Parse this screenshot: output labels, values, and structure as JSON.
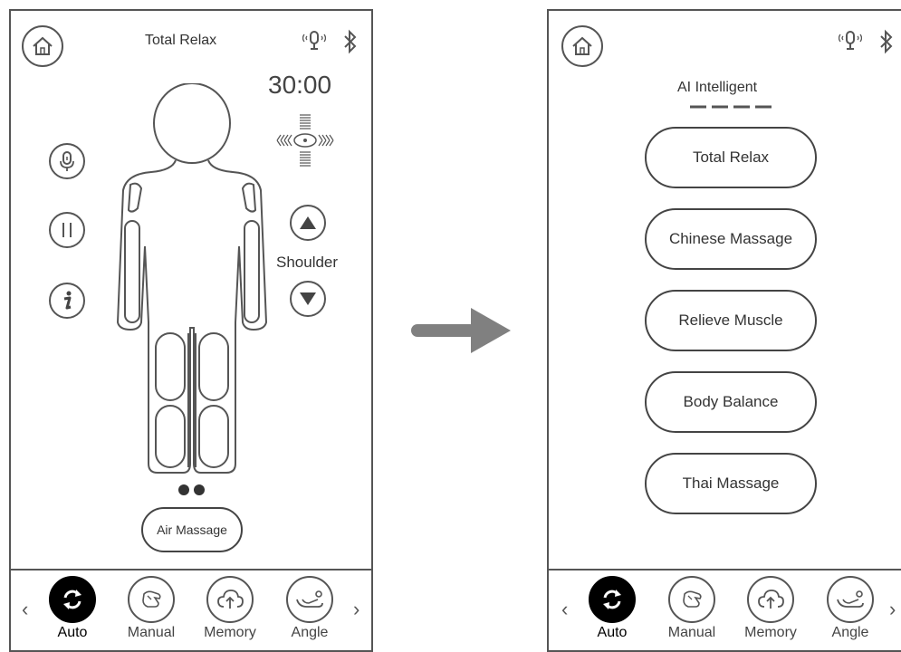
{
  "left_screen": {
    "title": "Total Relax",
    "timer": "30:00",
    "body_position_label": "Shoulder",
    "air_massage_button": "Air Massage",
    "icons": {
      "home": "home-icon",
      "voice": "microphone-icon",
      "bluetooth": "bluetooth-icon",
      "pause": "pause-icon",
      "info": "info-icon",
      "up": "triangle-up-icon",
      "down": "triangle-down-icon",
      "intensity": "intensity-cross-icon"
    }
  },
  "right_screen": {
    "section_title": "AI Intelligent",
    "programs": [
      "Total Relax",
      "Chinese Massage",
      "Relieve Muscle",
      "Body Balance",
      "Thai Massage"
    ]
  },
  "nav": {
    "prev": "‹",
    "next": "›",
    "items": [
      {
        "label": "Auto",
        "icon": "auto-sync-icon",
        "active": true
      },
      {
        "label": "Manual",
        "icon": "hand-icon",
        "active": false
      },
      {
        "label": "Memory",
        "icon": "cloud-upload-icon",
        "active": false
      },
      {
        "label": "Angle",
        "icon": "recline-icon",
        "active": false
      }
    ]
  },
  "arrow": "right-arrow-icon",
  "colors": {
    "stroke": "#555555",
    "active": "#000000",
    "arrow": "#808080"
  }
}
